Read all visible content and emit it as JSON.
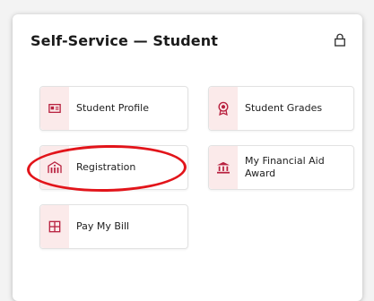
{
  "header": {
    "title": "Self-Service — Student"
  },
  "tiles": [
    {
      "label": "Student Profile",
      "icon": "id-card-icon"
    },
    {
      "label": "Student Grades",
      "icon": "award-icon"
    },
    {
      "label": "Registration",
      "icon": "building-icon"
    },
    {
      "label": "My Financial Aid Award",
      "icon": "bank-icon"
    },
    {
      "label": "Pay My Bill",
      "icon": "bill-grid-icon"
    }
  ],
  "colors": {
    "accent": "#b8213f",
    "icon_bg": "#fbeaea",
    "annotation": "#e2141a"
  }
}
